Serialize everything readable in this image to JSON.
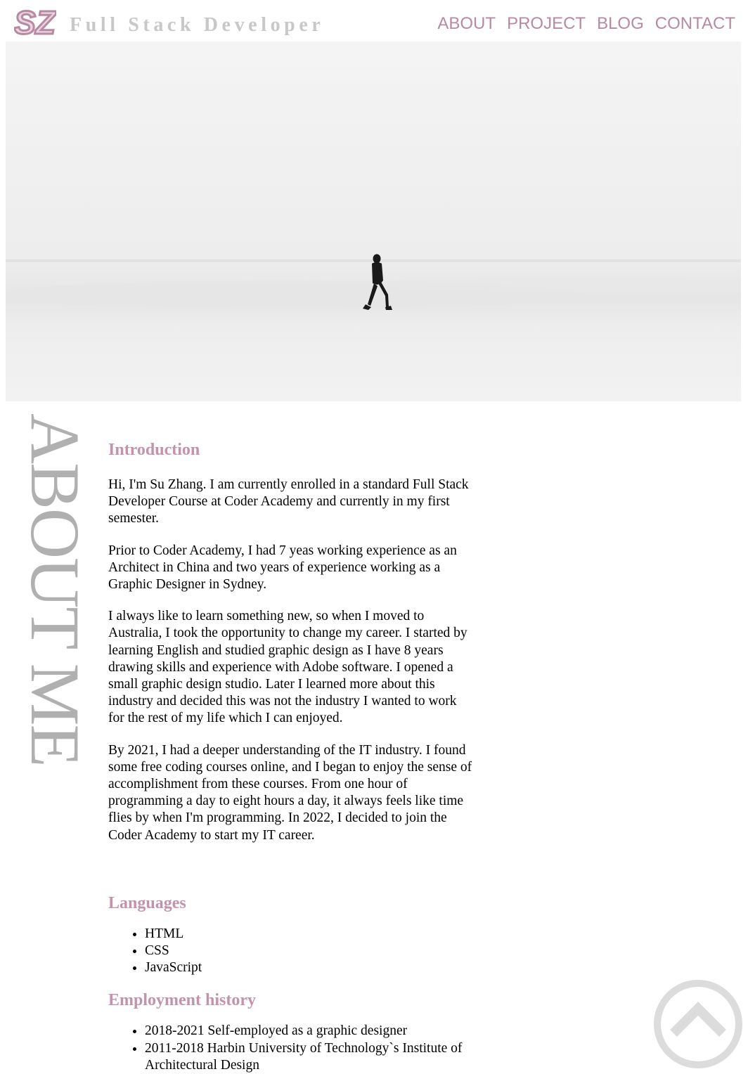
{
  "header": {
    "logo_text": "SZ",
    "tagline": "Full Stack Developer",
    "nav": [
      "ABOUT",
      "PROJECT",
      "BLOG",
      "CONTACT"
    ]
  },
  "hero": {
    "image_alt": "Person walking across a snowy white landscape"
  },
  "side_title": "ABOUT ME",
  "intro": {
    "heading": "Introduction",
    "paragraphs": [
      "Hi, I'm Su Zhang. I am currently enrolled in a standard Full Stack Developer Course at Coder Academy and currently in my first semester.",
      "Prior to Coder Academy, I had 7 yeas working experience as an Architect in China and two years of experience working as a Graphic Designer in Sydney.",
      "I always like to learn something new, so when I moved to Australia, I took the opportunity to change my career. I started by learning English and studied graphic design as I have 8 years drawing skills and experience with Adobe software. I opened a small graphic design studio. Later I learned more about this industry and decided this was not the industry I wanted to work for the rest of my life which I can enjoyed.",
      "By 2021, I had a deeper understanding of the IT industry. I found some free coding courses online, and I began to enjoy the sense of accomplishment from these courses. From one hour of programming a day to eight hours a day, it always feels like time flies by when I'm programming. In 2022, I decided to join the Coder Academy to start my IT career."
    ]
  },
  "languages": {
    "heading": "Languages",
    "items": [
      "HTML",
      "CSS",
      "JavaScript"
    ]
  },
  "employment": {
    "heading": "Employment history",
    "items": [
      "2018-2021 Self-employed as a graphic designer",
      "2011-2018 Harbin University of Technology`s Institute of Architectural Design"
    ]
  },
  "colors": {
    "accent": "#b889a3",
    "heading": "#c393ad",
    "muted": "#c8c8c8"
  },
  "icons": {
    "logo": "sz-logo-icon",
    "back_to_top": "chevron-up-circle-icon"
  }
}
